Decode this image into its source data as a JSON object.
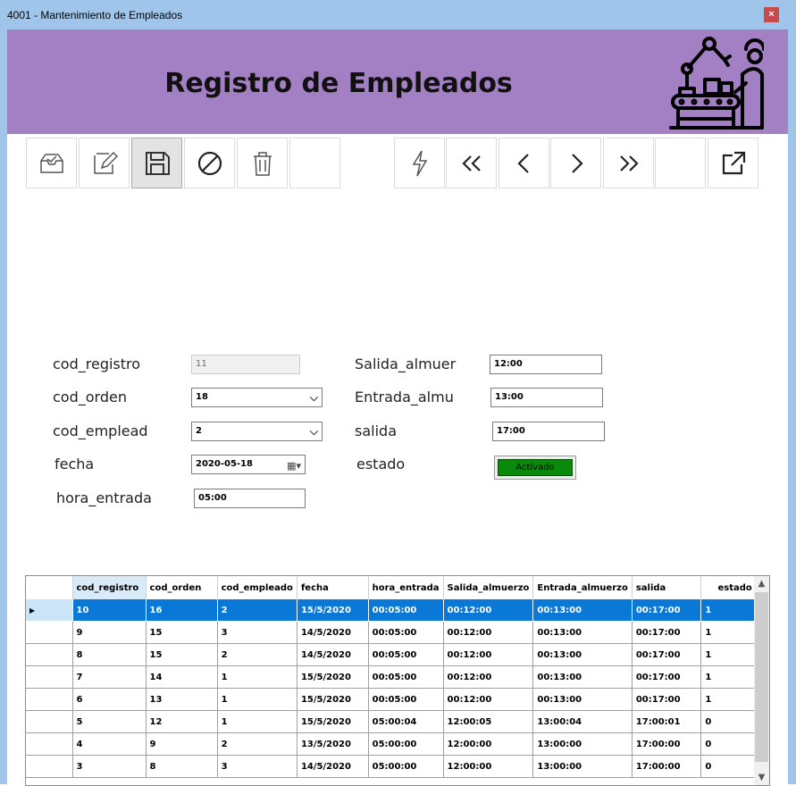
{
  "window": {
    "title": "4001 - Mantenimiento de Empleados",
    "close_glyph": "×"
  },
  "banner": {
    "title": "Registro de Empleados",
    "icon": "factory-worker-icon",
    "color": "#a37fc4"
  },
  "toolbar_left": [
    {
      "name": "new-record-button",
      "icon": "inbox-icon"
    },
    {
      "name": "edit-button",
      "icon": "edit-icon"
    },
    {
      "name": "save-button",
      "icon": "save-icon",
      "active": true
    },
    {
      "name": "cancel-button",
      "icon": "cancel-icon"
    },
    {
      "name": "delete-button",
      "icon": "trash-icon"
    },
    {
      "name": "empty-tool-button",
      "icon": ""
    }
  ],
  "toolbar_right": [
    {
      "name": "action-button",
      "icon": "lightning-icon",
      "glyph": ""
    },
    {
      "name": "first-record-button",
      "icon": "double-chevron-left-icon",
      "glyph": "<<"
    },
    {
      "name": "previous-record-button",
      "icon": "chevron-left-icon",
      "glyph": "<"
    },
    {
      "name": "next-record-button",
      "icon": "chevron-right-icon",
      "glyph": ">"
    },
    {
      "name": "last-record-button",
      "icon": "double-chevron-right-icon",
      "glyph": ">>"
    },
    {
      "name": "empty-nav-button",
      "icon": "",
      "glyph": ""
    },
    {
      "name": "export-button",
      "icon": "external-link-icon",
      "glyph": ""
    }
  ],
  "form": {
    "cod_registro": {
      "label": "cod_registro",
      "value": "11"
    },
    "cod_orden": {
      "label": "cod_orden",
      "value": "18"
    },
    "cod_emplead": {
      "label": "cod_emplead",
      "value": "2"
    },
    "fecha": {
      "label": "fecha",
      "value": "2020-05-18"
    },
    "hora_entrada": {
      "label": "hora_entrada",
      "value": "05:00"
    },
    "salida_almuer": {
      "label": "Salida_almuer",
      "value": "12:00"
    },
    "entrada_almu": {
      "label": "Entrada_almu",
      "value": "13:00"
    },
    "salida": {
      "label": "salida",
      "value": "17:00"
    },
    "estado": {
      "label": "estado",
      "value": "Activado",
      "color": "#0a8a0a"
    }
  },
  "grid": {
    "columns": [
      "cod_registro",
      "cod_orden",
      "cod_empleado",
      "fecha",
      "hora_entrada",
      "Salida_almuerzo",
      "Entrada_almuerzo",
      "salida",
      "estado"
    ],
    "rows": [
      [
        "10",
        "16",
        "2",
        "15/5/2020",
        "00:05:00",
        "00:12:00",
        "00:13:00",
        "00:17:00",
        "1"
      ],
      [
        "9",
        "15",
        "3",
        "14/5/2020",
        "00:05:00",
        "00:12:00",
        "00:13:00",
        "00:17:00",
        "1"
      ],
      [
        "8",
        "15",
        "2",
        "14/5/2020",
        "00:05:00",
        "00:12:00",
        "00:13:00",
        "00:17:00",
        "1"
      ],
      [
        "7",
        "14",
        "1",
        "15/5/2020",
        "00:05:00",
        "00:12:00",
        "00:13:00",
        "00:17:00",
        "1"
      ],
      [
        "6",
        "13",
        "1",
        "15/5/2020",
        "00:05:00",
        "00:12:00",
        "00:13:00",
        "00:17:00",
        "1"
      ],
      [
        "5",
        "12",
        "1",
        "15/5/2020",
        "05:00:04",
        "12:00:05",
        "13:00:04",
        "17:00:01",
        "0"
      ],
      [
        "4",
        "9",
        "2",
        "13/5/2020",
        "05:00:00",
        "12:00:00",
        "13:00:00",
        "17:00:00",
        "0"
      ],
      [
        "3",
        "8",
        "3",
        "14/5/2020",
        "05:00:00",
        "12:00:00",
        "13:00:00",
        "17:00:00",
        "0"
      ]
    ],
    "selected_row": 0,
    "selection_color": "#0a78d7"
  }
}
